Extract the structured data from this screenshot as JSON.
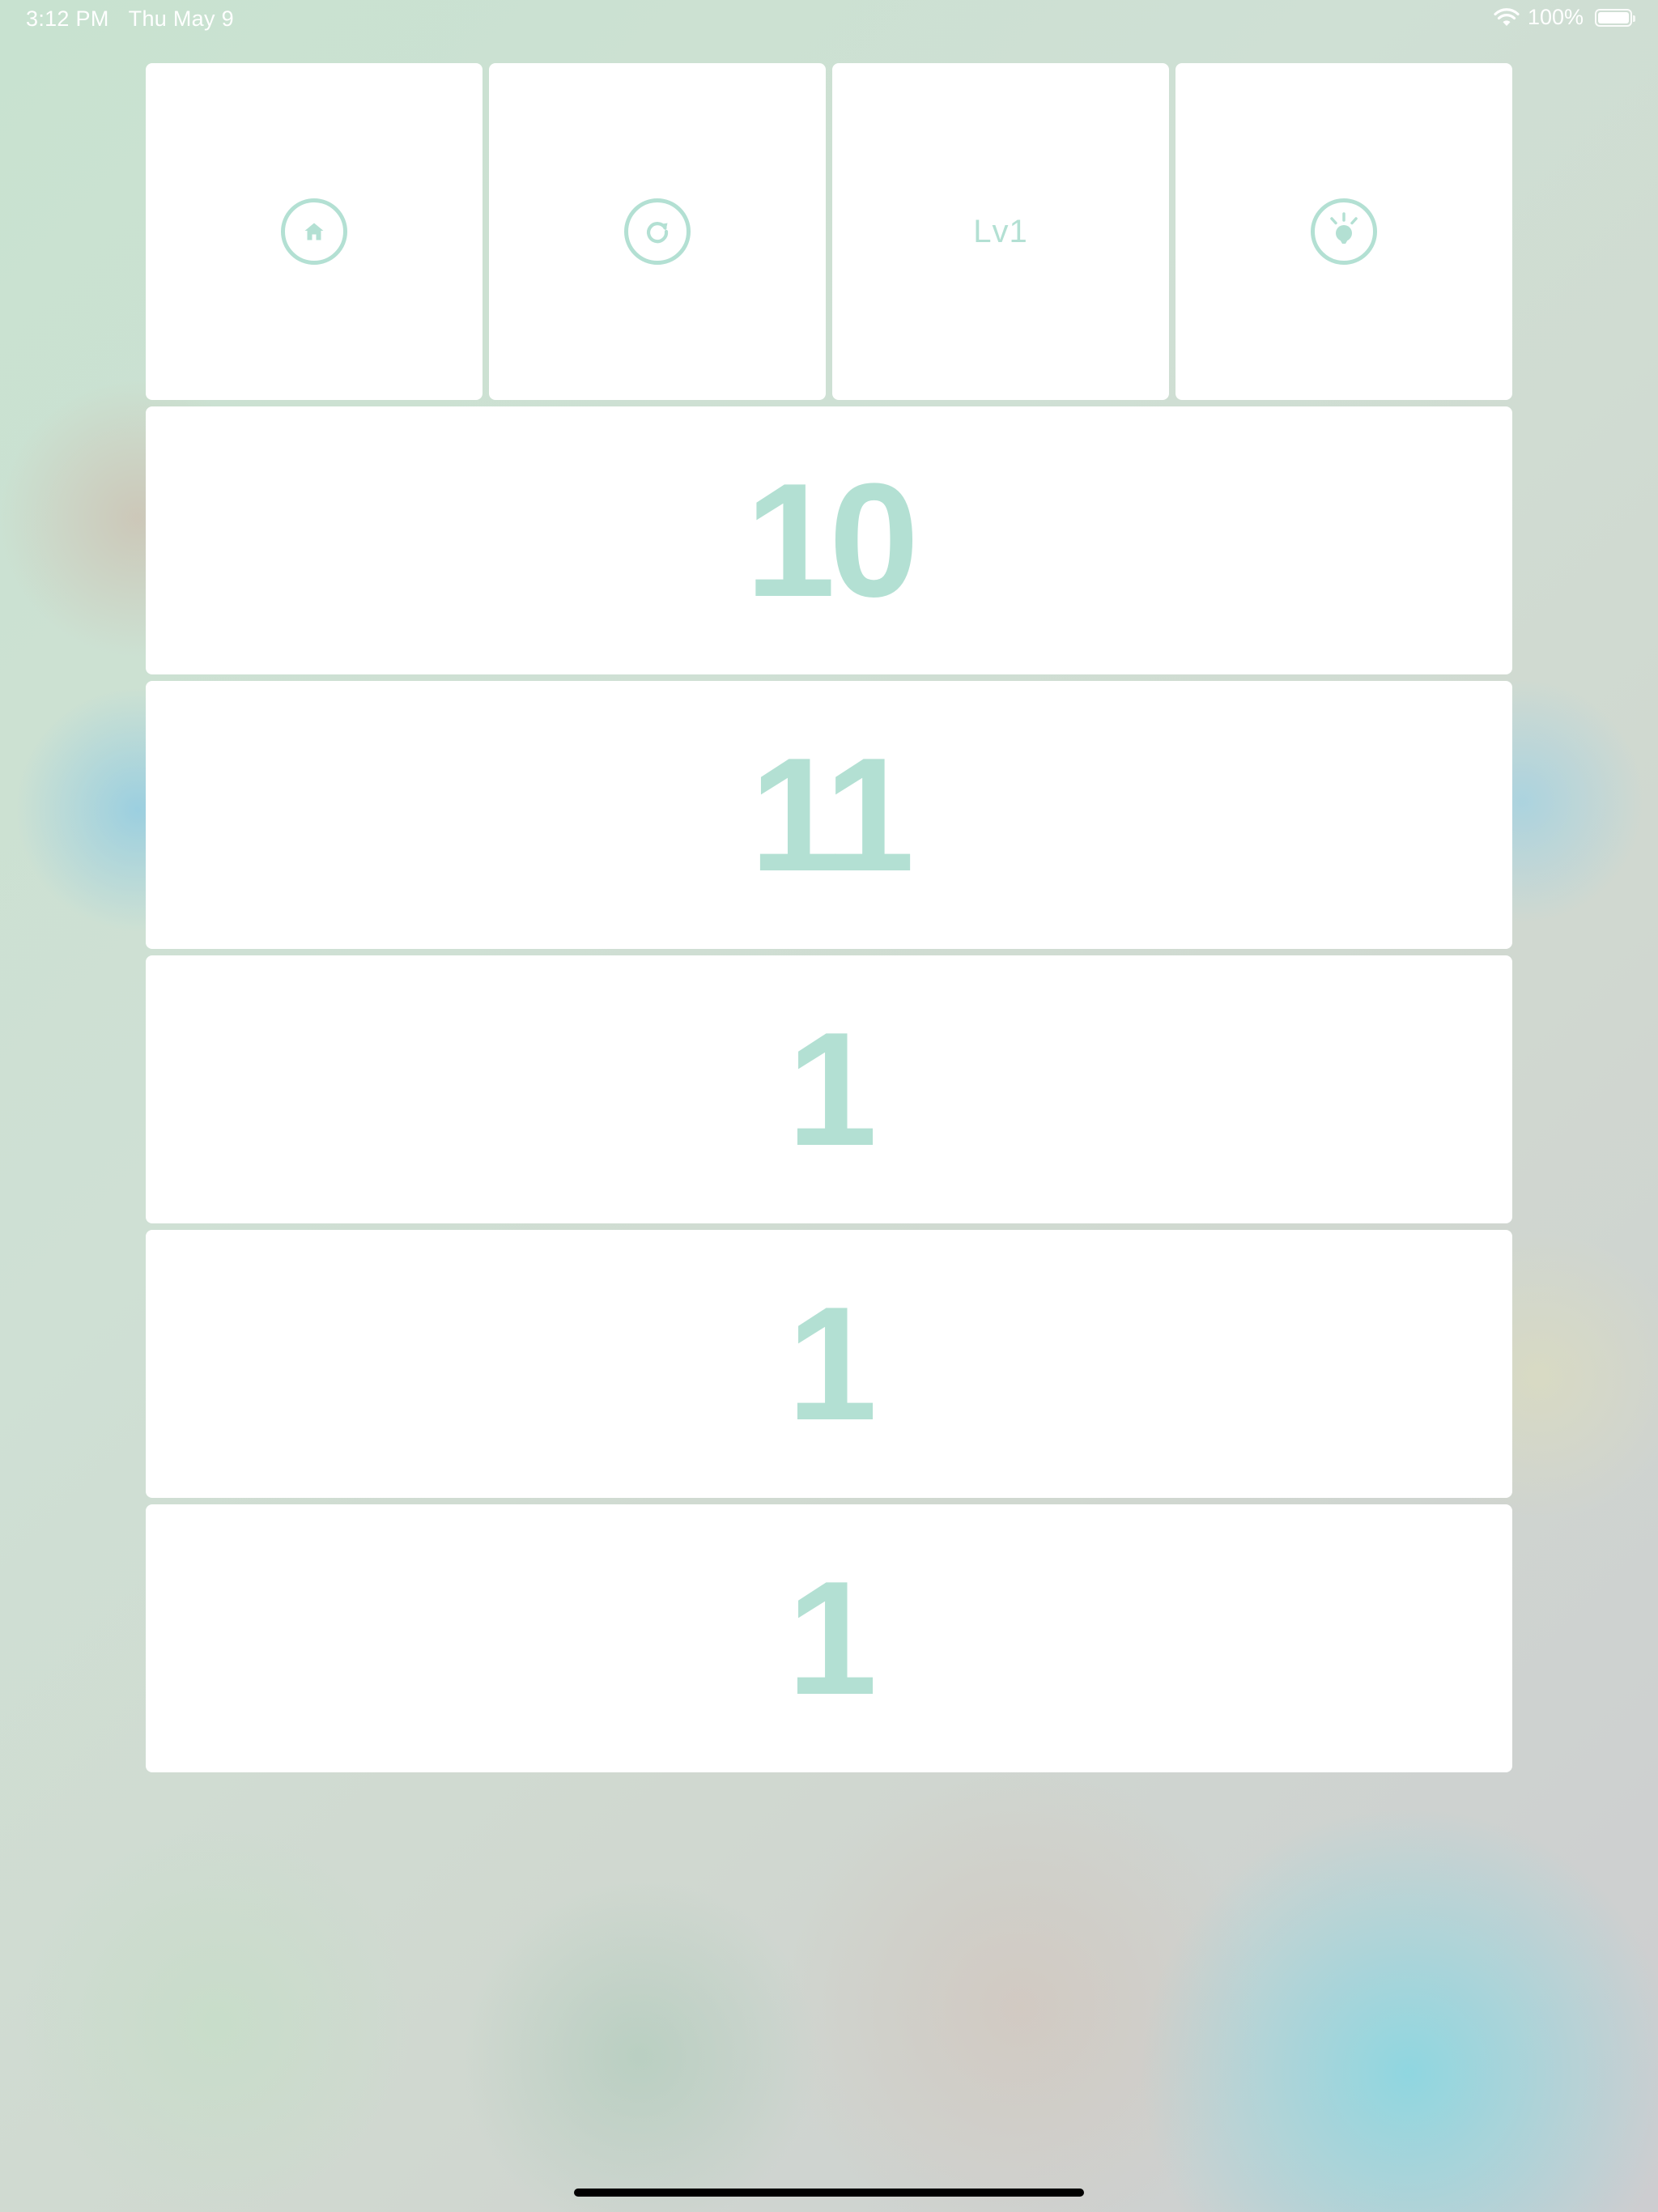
{
  "status_bar": {
    "time": "3:12 PM",
    "date": "Thu May 9",
    "battery_percent": "100%",
    "wifi_icon": "wifi-icon",
    "battery_icon": "battery-icon"
  },
  "toolbar": {
    "home_icon": "home-icon",
    "restart_icon": "restart-icon",
    "level_label": "Lv1",
    "hint_icon": "lightbulb-icon"
  },
  "rows": [
    {
      "value": "10"
    },
    {
      "value": "11"
    },
    {
      "value": "1"
    },
    {
      "value": "1"
    },
    {
      "value": "1"
    }
  ],
  "colors": {
    "accent": "#b3e0d3",
    "tile": "#ffffff",
    "status_text": "#ffffff"
  }
}
